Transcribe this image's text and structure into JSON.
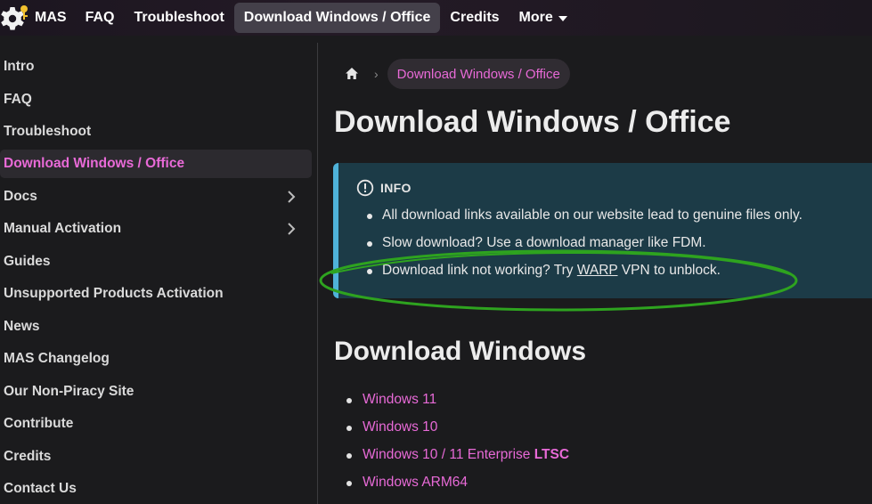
{
  "navbar": {
    "brand": "MAS",
    "items": [
      {
        "label": "FAQ",
        "active": false
      },
      {
        "label": "Troubleshoot",
        "active": false
      },
      {
        "label": "Download Windows / Office",
        "active": true
      },
      {
        "label": "Credits",
        "active": false
      },
      {
        "label": "More",
        "active": false,
        "dropdown": true
      }
    ]
  },
  "sidebar": {
    "items": [
      {
        "label": "Intro"
      },
      {
        "label": "FAQ"
      },
      {
        "label": "Troubleshoot"
      },
      {
        "label": "Download Windows / Office",
        "active": true
      },
      {
        "label": "Docs",
        "expandable": true
      },
      {
        "label": "Manual Activation",
        "expandable": true
      },
      {
        "label": "Guides"
      },
      {
        "label": "Unsupported Products Activation"
      },
      {
        "label": "News"
      },
      {
        "label": "MAS Changelog"
      },
      {
        "label": "Our Non-Piracy Site"
      },
      {
        "label": "Contribute"
      },
      {
        "label": "Credits"
      },
      {
        "label": "Contact Us"
      }
    ]
  },
  "breadcrumb": {
    "home_icon": "home-icon",
    "current": "Download Windows / Office"
  },
  "main": {
    "title": "Download Windows / Office",
    "info": {
      "title": "INFO",
      "icon": "info-circle-icon",
      "items": [
        "All download links available on our website lead to genuine files only.",
        "Slow download? Use a download manager like FDM."
      ],
      "item3": {
        "before": "Download link not working? Try ",
        "link": "WARP",
        "after": " VPN to unblock."
      }
    },
    "section_title": "Download Windows",
    "downloads": [
      {
        "label": "Windows 11"
      },
      {
        "label": "Windows 10"
      },
      {
        "label": "Windows 10 / 11 Enterprise ",
        "bold": "LTSC"
      },
      {
        "label": "Windows ARM64"
      }
    ]
  },
  "colors": {
    "accent": "#e86ad7",
    "info_bg": "#1c3b47",
    "info_border": "#4fb2d9",
    "highlight": "#2ea31f"
  }
}
